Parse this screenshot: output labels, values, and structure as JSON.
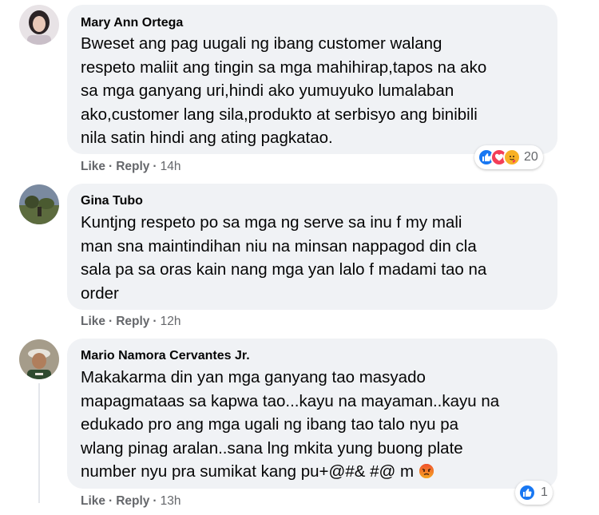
{
  "comments": [
    {
      "author": "Mary Ann Ortega",
      "lines": [
        "Bweset ang pag uugali ng ibang customer walang",
        "respeto maliit ang tingin sa mga mahihirap,tapos na ako",
        "sa mga ganyang uri,hindi ako yumuyuko lumalaban",
        "ako,customer lang sila,produkto at serbisyo ang binibili",
        "nila satin hindi ang ating pagkatao."
      ],
      "like_label": "Like",
      "reply_label": "Reply",
      "separator": "·",
      "time": "14h",
      "reaction_count": "20",
      "reactions": [
        "like-icon",
        "love-icon",
        "care-icon"
      ]
    },
    {
      "author": "Gina Tubo",
      "lines": [
        "Kuntjng respeto po sa mga ng serve sa inu f my mali",
        "man sna maintindihan niu na minsan nappagod din cla",
        "sala pa sa oras kain nang mga yan lalo f madami tao na",
        "order"
      ],
      "like_label": "Like",
      "reply_label": "Reply",
      "separator": "·",
      "time": "12h"
    },
    {
      "author": "Mario Namora Cervantes Jr.",
      "lines": [
        "Makakarma din yan mga ganyang tao masyado",
        "mapagmataas sa kapwa tao...kayu na mayaman..kayu na",
        "edukado pro ang mga ugali ng ibang tao talo nyu pa",
        "wlang pinag aralan..sana lng mkita yung buong plate",
        "number nyu pra sumikat kang pu+@#& #@ m"
      ],
      "like_label": "Like",
      "reply_label": "Reply",
      "separator": "·",
      "time": "13h",
      "reaction_count": "1",
      "reactions": [
        "like-icon"
      ]
    }
  ],
  "colors": {
    "bubble": "#f0f2f5",
    "meta": "#65676b",
    "like_blue": "#1877f2",
    "love_red": "#f33e58",
    "care_yellow": "#f7b125"
  }
}
